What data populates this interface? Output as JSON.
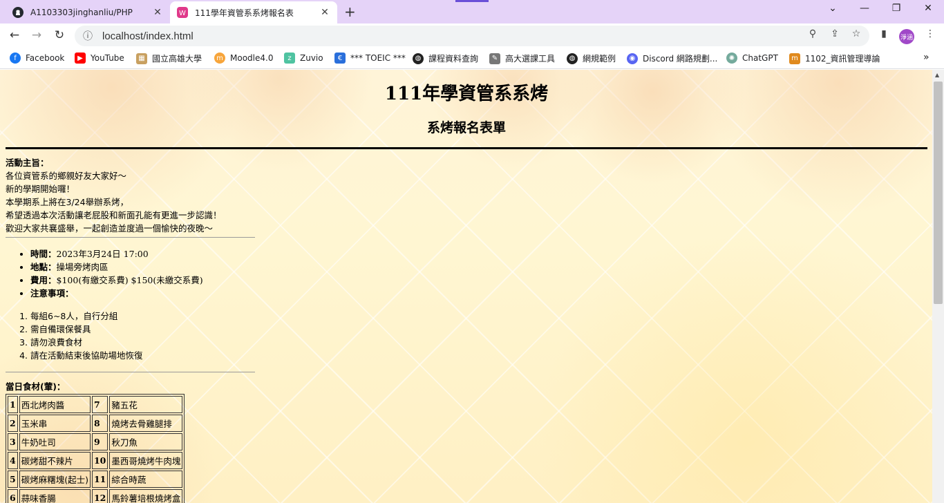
{
  "tabs": [
    {
      "title": "A1103303jinghanliu/PHP",
      "favicon": "github-icon"
    },
    {
      "title": "111學年資管系系烤報名表",
      "favicon": "page-icon"
    }
  ],
  "address": {
    "url": "localhost/index.html"
  },
  "profile": {
    "initials": "淨涵"
  },
  "bookmarks": [
    {
      "label": "Facebook",
      "icon": "facebook-icon",
      "color": "#1877f2"
    },
    {
      "label": "YouTube",
      "icon": "youtube-icon",
      "color": "#ff0000"
    },
    {
      "label": "國立高雄大學",
      "icon": "university-icon",
      "color": "#c8a060"
    },
    {
      "label": "Moodle4.0",
      "icon": "moodle-icon",
      "color": "#f7a53b"
    },
    {
      "label": "Zuvio",
      "icon": "zuvio-icon",
      "color": "#4fc3a1"
    },
    {
      "label": "*** TOEIC ***",
      "icon": "toeic-icon",
      "color": "#2a6fdb"
    },
    {
      "label": "課程資料查詢",
      "icon": "globe-icon",
      "color": "#222222"
    },
    {
      "label": "高大選課工具",
      "icon": "wrench-icon",
      "color": "#555555"
    },
    {
      "label": "網規範例",
      "icon": "globe-icon",
      "color": "#222222"
    },
    {
      "label": "Discord 網路規劃...",
      "icon": "discord-icon",
      "color": "#5865f2"
    },
    {
      "label": "ChatGPT",
      "icon": "chatgpt-icon",
      "color": "#74aa9c"
    },
    {
      "label": "1102_資訊管理導論",
      "icon": "course-icon",
      "color": "#e08a1e"
    }
  ],
  "page": {
    "title": "111年學資管系系烤",
    "subtitle": "系烤報名表單",
    "intro_label": "活動主旨：",
    "intro_lines": [
      "各位資管系的鄉親好友大家好～",
      "新的學期開始囉！",
      "本學期系上將在3/24舉辦系烤，",
      "希望透過本次活動讓老屁股和新面孔能有更進一步認識！",
      "歡迎大家共襄盛舉，一起創造並度過一個愉快的夜晚～"
    ],
    "info": [
      {
        "label": "時間：",
        "value": "2023年3月24日 17:00"
      },
      {
        "label": "地點：",
        "value": "操場旁烤肉區"
      },
      {
        "label": "費用：",
        "value": "$100(有繳交系費) $150(未繳交系費)"
      },
      {
        "label": "注意事項：",
        "value": ""
      }
    ],
    "notes": [
      "每組6~8人，自行分組",
      "需自備環保餐具",
      "請勿浪費食材",
      "請在活動結束後協助場地恢復"
    ],
    "food_caption": "當日食材(葷)：",
    "food_rows": [
      [
        {
          "n": "1",
          "name": "西北烤肉醬"
        },
        {
          "n": "7",
          "name": "豬五花"
        }
      ],
      [
        {
          "n": "2",
          "name": "玉米串"
        },
        {
          "n": "8",
          "name": "燒烤去骨雞腿排"
        }
      ],
      [
        {
          "n": "3",
          "name": "牛奶吐司"
        },
        {
          "n": "9",
          "name": "秋刀魚"
        }
      ],
      [
        {
          "n": "4",
          "name": "碳烤甜不辣片"
        },
        {
          "n": "10",
          "name": "墨西哥燒烤牛肉塊"
        }
      ],
      [
        {
          "n": "5",
          "name": "碳烤麻糬塊(起士)"
        },
        {
          "n": "11",
          "name": "綜合時蔬"
        }
      ],
      [
        {
          "n": "6",
          "name": "蒜味香腸"
        },
        {
          "n": "12",
          "name": "馬鈴薯培根燒烤盒"
        }
      ]
    ]
  }
}
